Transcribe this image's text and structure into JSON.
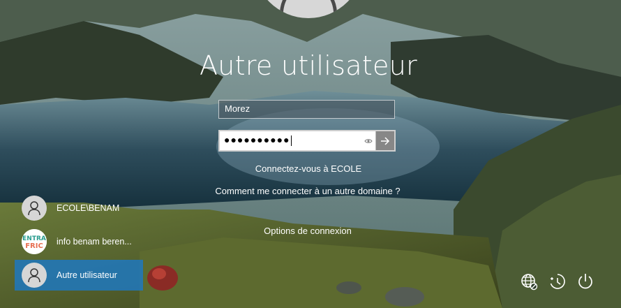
{
  "login": {
    "title": "Autre utilisateur",
    "username_value": "Morez",
    "password_mask": "●●●●●●●●●●",
    "sign_in_to": "Connectez-vous à ECOLE",
    "other_domain_help": "Comment me connecter à un autre domaine ?",
    "sign_in_options": "Options de connexion"
  },
  "users": [
    {
      "name": "ECOLE\\BENAM",
      "avatar": "person-icon",
      "selected": false
    },
    {
      "name": "info benam beren...",
      "avatar": "entrafric-logo",
      "selected": false
    },
    {
      "name": "Autre utilisateur",
      "avatar": "person-icon",
      "selected": true
    }
  ],
  "logo_text": [
    "ENTRA",
    "FRIC"
  ],
  "tray": {
    "network_icon": "network-globe-icon",
    "accessibility_icon": "ease-of-access-icon",
    "power_icon": "power-icon"
  },
  "colors": {
    "selected_user": "#1e78be",
    "submit_button": "#5f5f5f"
  }
}
